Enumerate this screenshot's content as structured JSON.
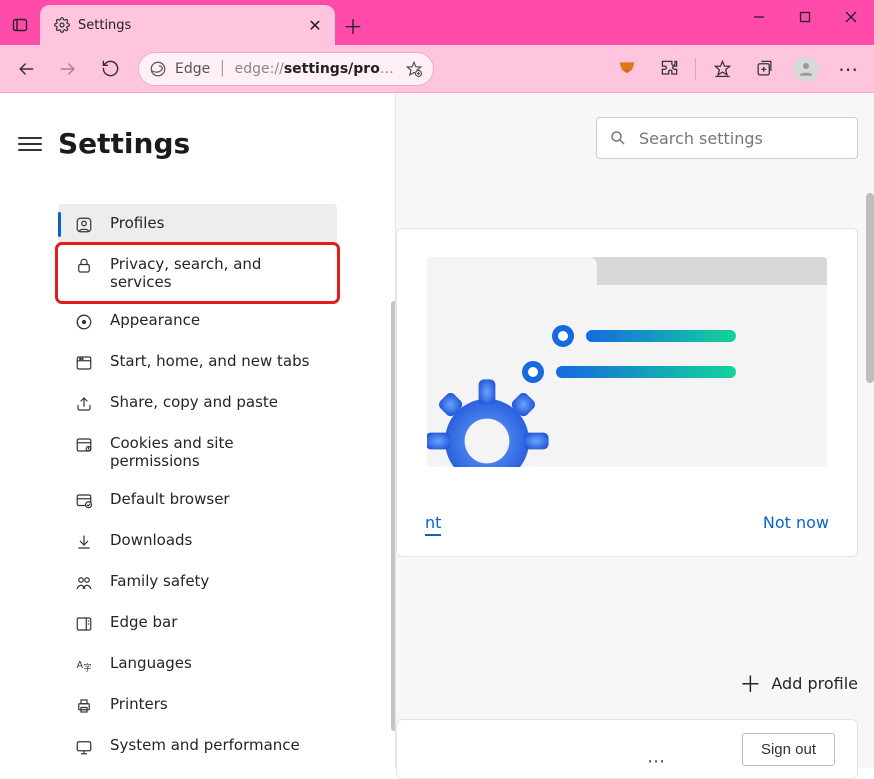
{
  "tab": {
    "title": "Settings"
  },
  "address": {
    "product": "Edge",
    "url_prefix": "edge://",
    "url_bold": "settings/pro",
    "url_ellipsis": "…"
  },
  "page": {
    "title": "Settings",
    "search_placeholder": "Search settings"
  },
  "nav": {
    "items": [
      {
        "label": "Profiles"
      },
      {
        "label": "Privacy, search, and services"
      },
      {
        "label": "Appearance"
      },
      {
        "label": "Start, home, and new tabs"
      },
      {
        "label": "Share, copy and paste"
      },
      {
        "label": "Cookies and site permissions"
      },
      {
        "label": "Default browser"
      },
      {
        "label": "Downloads"
      },
      {
        "label": "Family safety"
      },
      {
        "label": "Edge bar"
      },
      {
        "label": "Languages"
      },
      {
        "label": "Printers"
      },
      {
        "label": "System and performance"
      }
    ]
  },
  "card": {
    "link_left": "nt",
    "link_right": "Not now"
  },
  "right_actions": {
    "add_profile": "Add profile",
    "sign_out": "Sign out"
  }
}
